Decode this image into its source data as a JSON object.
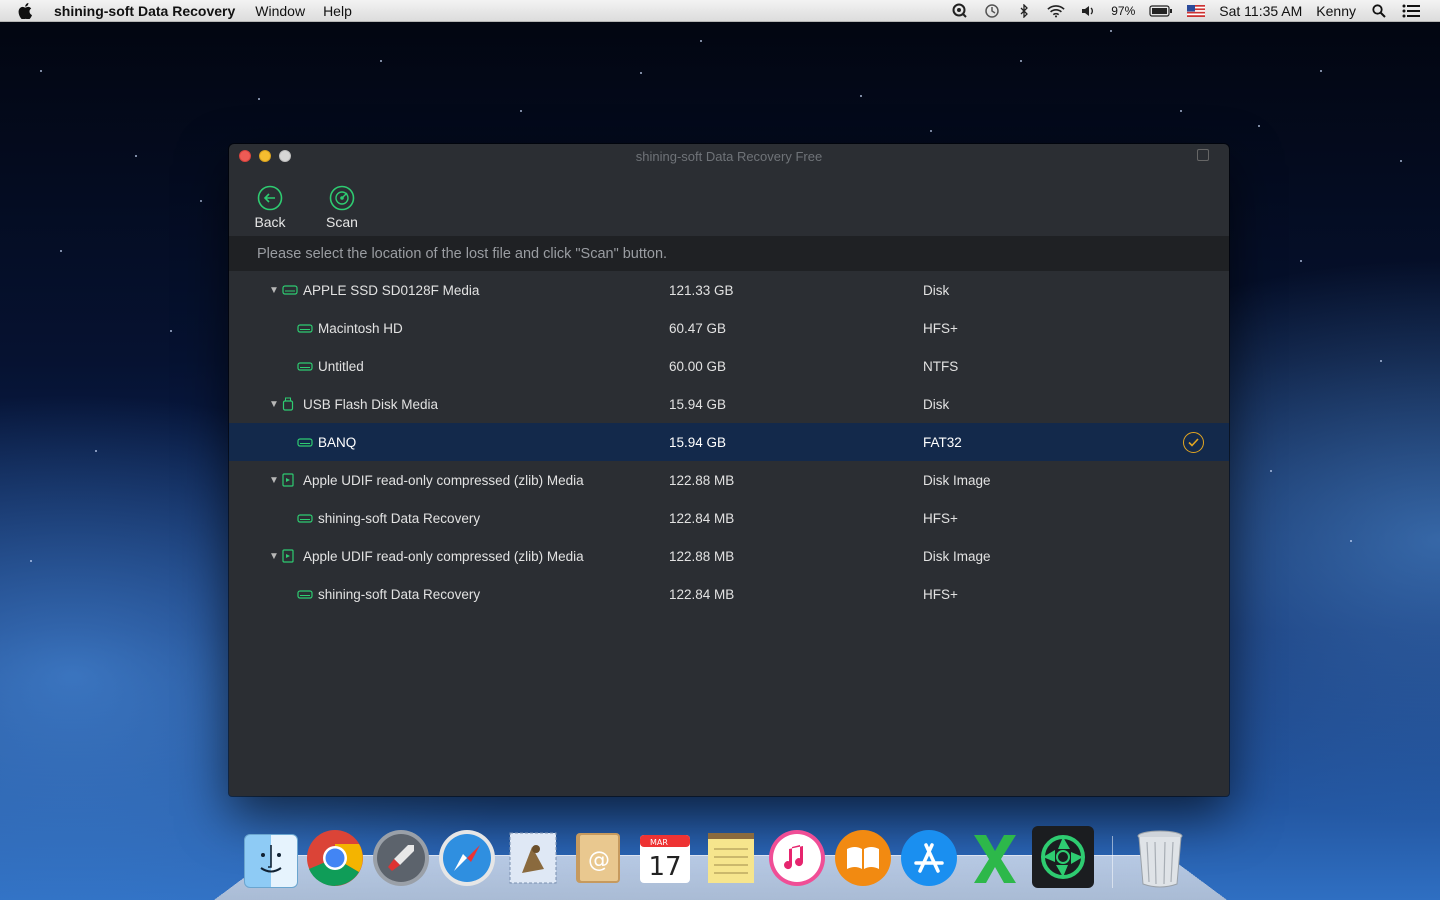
{
  "menubar": {
    "app_name": "shining-soft Data Recovery",
    "menus": [
      "Window",
      "Help"
    ],
    "battery": "97%",
    "clock": "Sat 11:35 AM",
    "user": "Kenny"
  },
  "window": {
    "title": "shining-soft Data Recovery Free",
    "toolbar": {
      "back_label": "Back",
      "scan_label": "Scan"
    },
    "hint": "Please select the location of the lost file and click \"Scan\" button.",
    "accent_color": "#2ecc71",
    "selected_color": "#13294b",
    "rows": [
      {
        "name": "APPLE SSD SD0128F Media",
        "size": "121.33 GB",
        "type": "Disk",
        "level": 0,
        "icon": "internal-disk-icon"
      },
      {
        "name": "Macintosh HD",
        "size": "60.47 GB",
        "type": "HFS+",
        "level": 1,
        "icon": "volume-icon"
      },
      {
        "name": "Untitled",
        "size": "60.00 GB",
        "type": "NTFS",
        "level": 1,
        "icon": "volume-icon"
      },
      {
        "name": "USB Flash Disk Media",
        "size": "15.94 GB",
        "type": "Disk",
        "level": 0,
        "icon": "usb-drive-icon"
      },
      {
        "name": "BANQ",
        "size": "15.94 GB",
        "type": "FAT32",
        "level": 1,
        "icon": "volume-icon",
        "selected": true
      },
      {
        "name": "Apple UDIF read-only compressed (zlib) Media",
        "size": "122.88 MB",
        "type": "Disk Image",
        "level": 0,
        "icon": "disk-image-icon"
      },
      {
        "name": "shining-soft Data Recovery",
        "size": "122.84 MB",
        "type": "HFS+",
        "level": 1,
        "icon": "volume-icon"
      },
      {
        "name": "Apple UDIF read-only compressed (zlib) Media",
        "size": "122.88 MB",
        "type": "Disk Image",
        "level": 0,
        "icon": "disk-image-icon"
      },
      {
        "name": "shining-soft Data Recovery",
        "size": "122.84 MB",
        "type": "HFS+",
        "level": 1,
        "icon": "volume-icon"
      }
    ]
  },
  "dock": {
    "apps": [
      "finder-icon",
      "chrome-icon",
      "launchpad-icon",
      "safari-icon",
      "mail-icon",
      "contacts-icon",
      "calendar-icon",
      "notes-icon",
      "itunes-icon",
      "ibooks-icon",
      "app-store-icon",
      "excel-icon",
      "data-recovery-icon",
      "trash-icon"
    ],
    "calendar_month": "MAR",
    "calendar_day": "17"
  }
}
